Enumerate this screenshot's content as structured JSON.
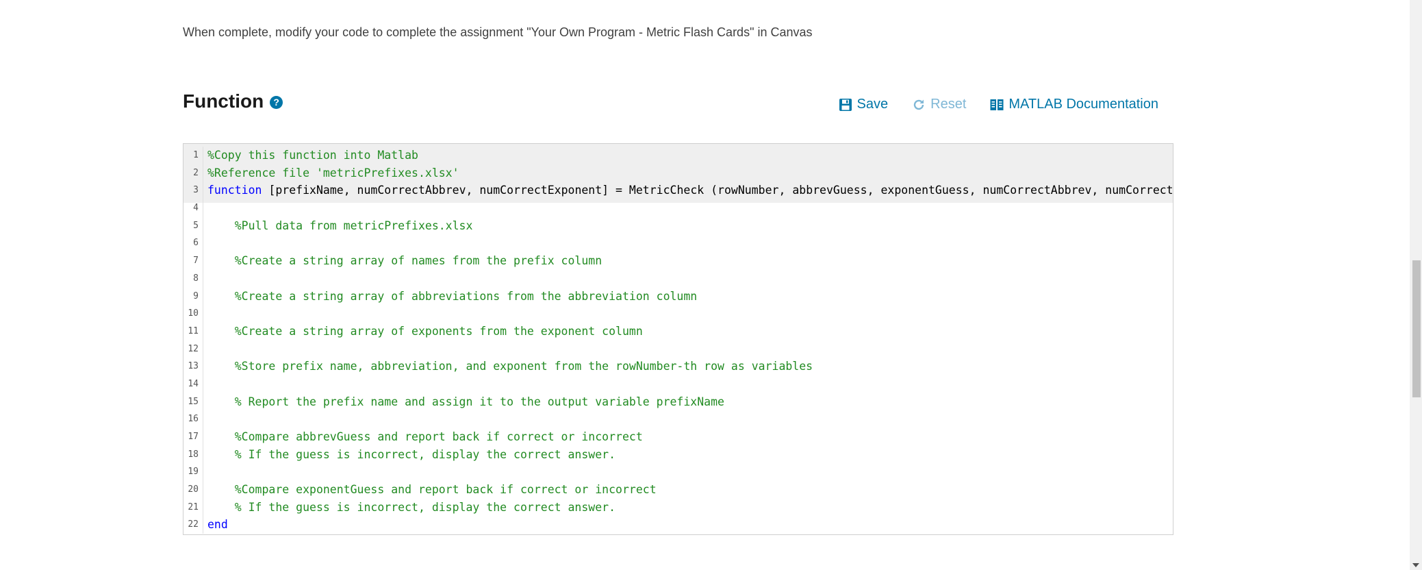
{
  "intro_text": "When complete, modify your code to complete the assignment \"Your Own Program - Metric Flash Cards\" in Canvas",
  "section": {
    "title": "Function",
    "help_icon": "question-circle-icon"
  },
  "toolbar": {
    "save_label": "Save",
    "reset_label": "Reset",
    "docs_label": "MATLAB Documentation",
    "accent_color": "#0076a8",
    "disabled_color": "#7fb7d6"
  },
  "code": {
    "lines": [
      {
        "n": "1",
        "type": "comment",
        "text": "%Copy this function into Matlab"
      },
      {
        "n": "2",
        "type": "comment",
        "text": "%Reference file 'metricPrefixes.xlsx'"
      },
      {
        "n": "3",
        "type": "function",
        "kw": "function",
        "text": " [prefixName, numCorrectAbbrev, numCorrectExponent] = MetricCheck (rowNumber, abbrevGuess, exponentGuess, numCorrectAbbrev, numCorrectExpo"
      },
      {
        "n": "4",
        "type": "blank",
        "text": ""
      },
      {
        "n": "5",
        "type": "comment",
        "text": "    %Pull data from metricPrefixes.xlsx"
      },
      {
        "n": "6",
        "type": "blank",
        "text": ""
      },
      {
        "n": "7",
        "type": "comment",
        "text": "    %Create a string array of names from the prefix column"
      },
      {
        "n": "8",
        "type": "blank",
        "text": ""
      },
      {
        "n": "9",
        "type": "comment",
        "text": "    %Create a string array of abbreviations from the abbreviation column"
      },
      {
        "n": "10",
        "type": "blank",
        "text": ""
      },
      {
        "n": "11",
        "type": "comment",
        "text": "    %Create a string array of exponents from the exponent column"
      },
      {
        "n": "12",
        "type": "blank",
        "text": ""
      },
      {
        "n": "13",
        "type": "comment",
        "text": "    %Store prefix name, abbreviation, and exponent from the rowNumber-th row as variables"
      },
      {
        "n": "14",
        "type": "blank",
        "text": ""
      },
      {
        "n": "15",
        "type": "comment",
        "text": "    % Report the prefix name and assign it to the output variable prefixName"
      },
      {
        "n": "16",
        "type": "blank",
        "text": ""
      },
      {
        "n": "17",
        "type": "comment",
        "text": "    %Compare abbrevGuess and report back if correct or incorrect"
      },
      {
        "n": "18",
        "type": "comment",
        "text": "    % If the guess is incorrect, display the correct answer."
      },
      {
        "n": "19",
        "type": "blank",
        "text": ""
      },
      {
        "n": "20",
        "type": "comment",
        "text": "    %Compare exponentGuess and report back if correct or incorrect"
      },
      {
        "n": "21",
        "type": "comment",
        "text": "    % If the guess is incorrect, display the correct answer."
      },
      {
        "n": "22",
        "type": "keyword",
        "text": "end"
      }
    ]
  }
}
